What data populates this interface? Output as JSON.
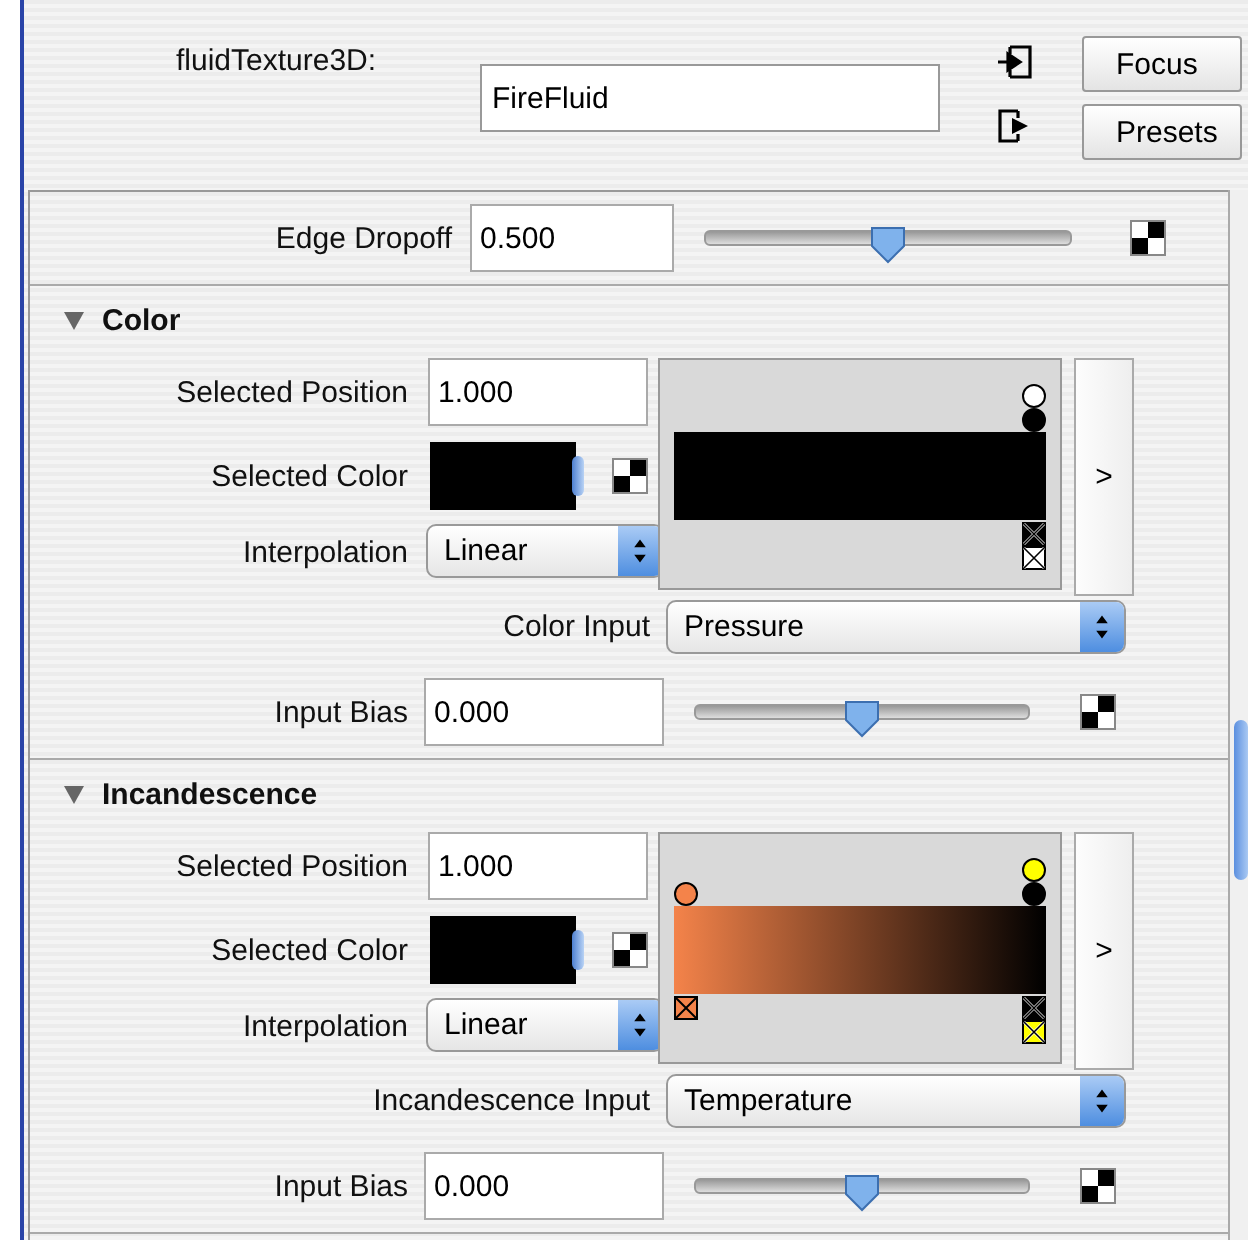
{
  "node": {
    "label": "fluidTexture3D:",
    "name": "FireFluid"
  },
  "buttons": [
    "Focus",
    "Presets"
  ],
  "edge_dropoff": {
    "label": "Edge Dropoff",
    "value": "0.500",
    "level": 0.5
  },
  "sections": [
    {
      "title": "Color",
      "expanded": true,
      "selected_position": {
        "label": "Selected Position",
        "value": "1.000"
      },
      "selected_color": {
        "label": "Selected Color",
        "color": "#000000"
      },
      "interpolation": {
        "label": "Interpolation",
        "value": "Linear"
      },
      "ramp": {
        "bar_colors": [
          {
            "color": "#000000"
          }
        ],
        "markers": [
          {
            "kind": "end",
            "color": "#ffffff"
          },
          {
            "kind": "end",
            "color": "#000000"
          }
        ]
      },
      "expand_button": ">",
      "input": {
        "label": "Color Input",
        "value": "Pressure"
      },
      "bias": {
        "label": "Input Bias",
        "value": "0.000",
        "level": 0.5
      }
    },
    {
      "title": "Incandescence",
      "expanded": true,
      "selected_position": {
        "label": "Selected Position",
        "value": "1.000"
      },
      "selected_color": {
        "label": "Selected Color",
        "color": "#000000"
      },
      "interpolation": {
        "label": "Interpolation",
        "value": "Linear"
      },
      "ramp": {
        "bar_colors": [
          {
            "color": "#f4834a"
          },
          {
            "color": "#000000"
          }
        ],
        "markers": [
          {
            "kind": "end",
            "color": "#ffff00"
          },
          {
            "kind": "end",
            "color": "#000000"
          },
          {
            "kind": "start",
            "color": "#f4834a"
          }
        ]
      },
      "expand_button": ">",
      "input": {
        "label": "Incandescence Input",
        "value": "Temperature"
      },
      "bias": {
        "label": "Input Bias",
        "value": "0.000",
        "level": 0.5
      }
    }
  ]
}
